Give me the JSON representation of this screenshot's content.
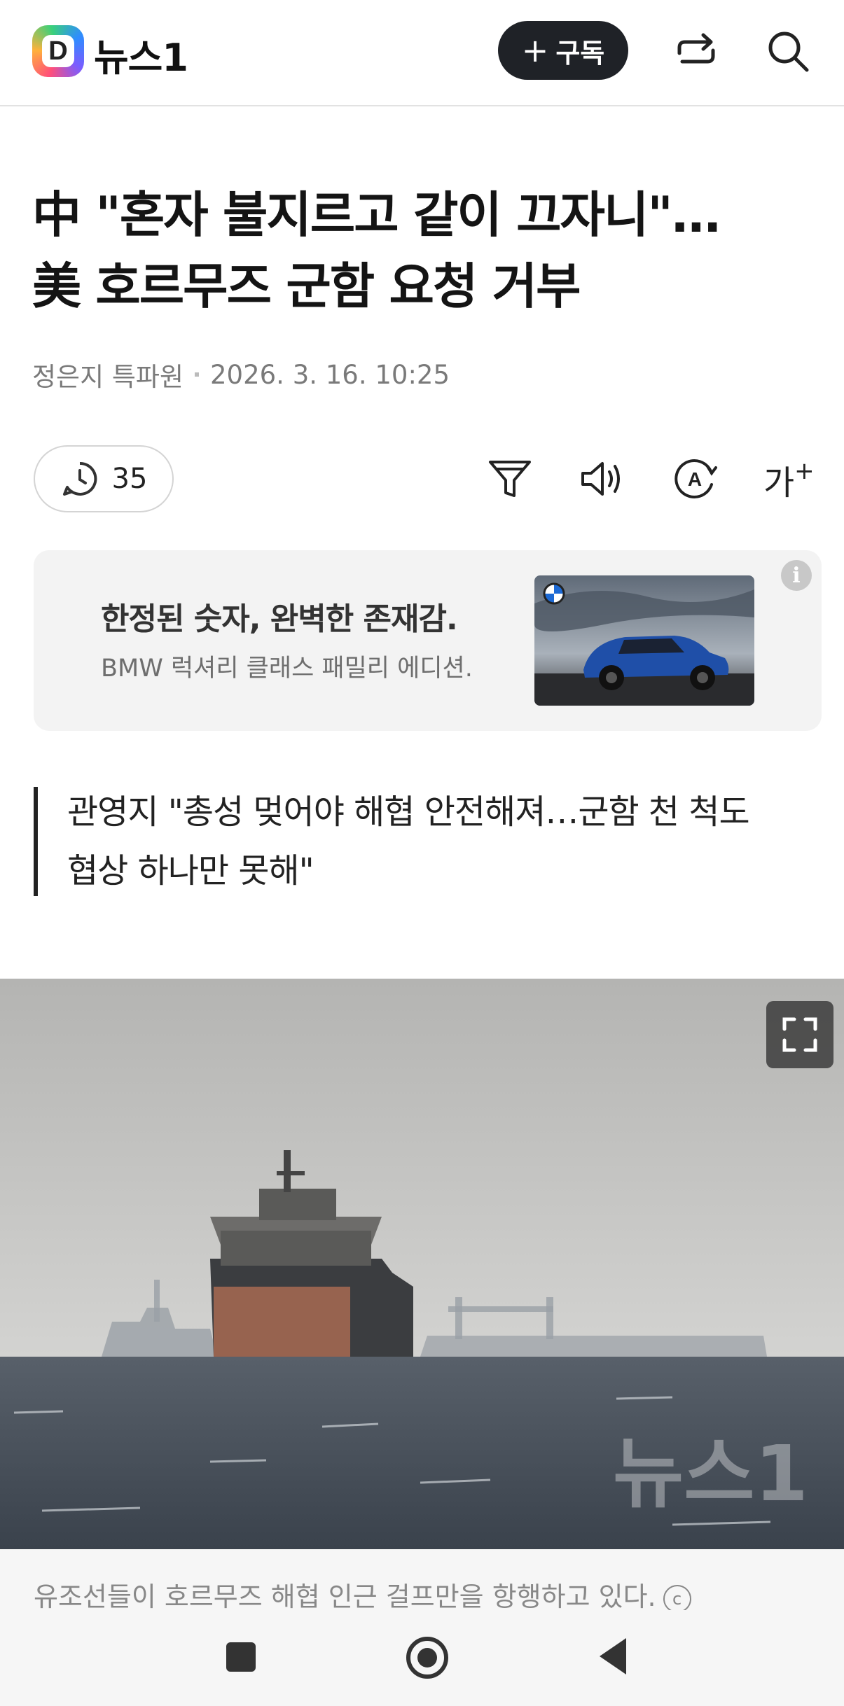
{
  "header": {
    "logo_letter": "D",
    "brand": "뉴스1",
    "subscribe_label": "구독",
    "subscribe_plus": "+",
    "share_icon": "share-icon",
    "search_icon": "search-icon"
  },
  "article": {
    "title_line1": "中 \"혼자 불지르고 같이 끄자니\"…",
    "title_line2": "美 호르무즈 군함 요청 거부",
    "author": "정은지 특파원",
    "datetime": "2026. 3. 16. 10:25",
    "comment_count": "35",
    "font_size_label": "가"
  },
  "ad": {
    "headline": "한정된 숫자, 완벽한 존재감.",
    "sub": "BMW 럭셔리 클래스 패밀리 에디션.",
    "info_label": "i"
  },
  "quote": {
    "line1": "관영지 \"총성 멎어야 해협 안전해져…군함 천 척도",
    "line2": "협상 하나만 못해\""
  },
  "photo": {
    "watermark": "뉴스1",
    "caption": "유조선들이 호르무즈 해협 인근 걸프만을 항행하고 있다.",
    "copyright_symbol": "c"
  },
  "colors": {
    "subscribe_bg": "#1f2227",
    "ad_bg": "#f3f3f3",
    "caption_text": "#888888"
  }
}
